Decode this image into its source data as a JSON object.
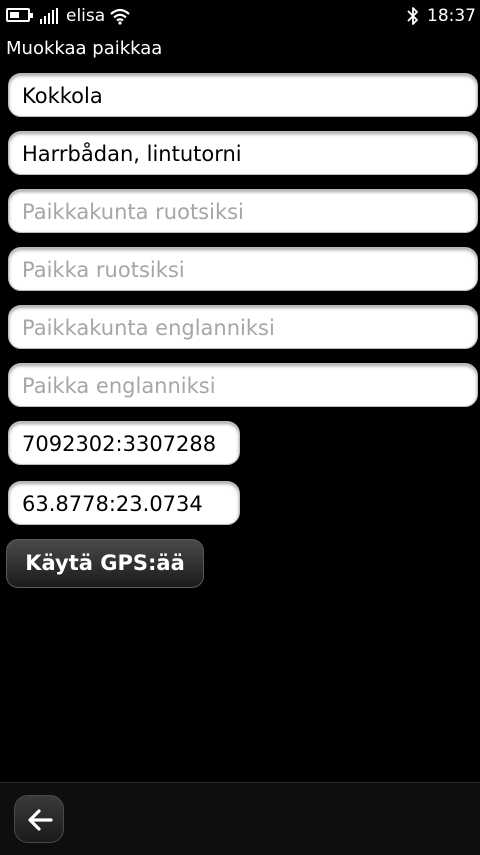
{
  "status_bar": {
    "operator": "elisa",
    "time": "18:37",
    "battery_icon": "battery-icon",
    "signal_icon": "signal-icon",
    "wifi_icon": "wifi-icon",
    "bluetooth_icon": "bluetooth-icon"
  },
  "page": {
    "title": "Muokkaa paikkaa"
  },
  "form": {
    "city": {
      "value": "Kokkola",
      "placeholder": ""
    },
    "place": {
      "value": "Harrbådan, lintutorni",
      "placeholder": ""
    },
    "city_swedish": {
      "value": "",
      "placeholder": "Paikkakunta ruotsiksi"
    },
    "place_swedish": {
      "value": "",
      "placeholder": "Paikka ruotsiksi"
    },
    "city_english": {
      "value": "",
      "placeholder": "Paikkakunta englanniksi"
    },
    "place_english": {
      "value": "",
      "placeholder": "Paikka englanniksi"
    },
    "grid_coordinates": {
      "value": "7092302:3307288"
    },
    "gps_coordinates": {
      "value": "63.8778:23.0734"
    },
    "gps_button_label": "Käytä GPS:ää"
  },
  "toolbar": {
    "back_icon": "back-arrow-icon"
  },
  "colors": {
    "background": "#000000",
    "field_background": "#ffffff",
    "placeholder_text": "#a6a6a6",
    "button_background": "#2a2a2a"
  }
}
